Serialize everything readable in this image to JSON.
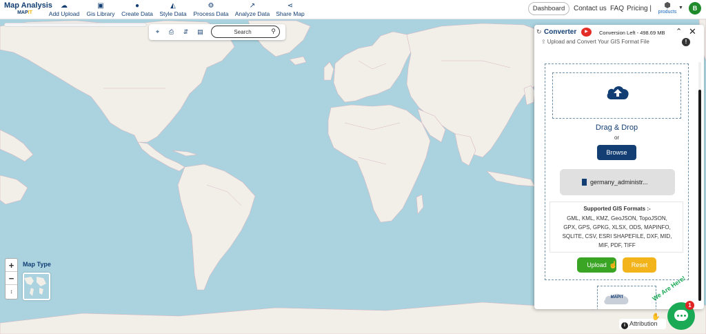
{
  "brand": {
    "title": "Map Analysis",
    "sub_prefix": "MAP",
    "sub_suffix": "IT"
  },
  "nav": [
    {
      "label": "Add Upload",
      "icon": "cloud-upload-icon"
    },
    {
      "label": "Gis Library",
      "icon": "library-icon"
    },
    {
      "label": "Create Data",
      "icon": "location-pin-icon"
    },
    {
      "label": "Style Data",
      "icon": "style-icon"
    },
    {
      "label": "Process Data",
      "icon": "process-icon"
    },
    {
      "label": "Analyze Data",
      "icon": "analyze-icon"
    },
    {
      "label": "Share Map",
      "icon": "share-icon"
    }
  ],
  "header": {
    "dashboard": "Dashboard",
    "contact": "Contact us",
    "faq": "FAQ",
    "pricing": "Pricing |",
    "products": "products",
    "avatar": "B"
  },
  "map_toolbar": {
    "search_placeholder": "Search"
  },
  "map_controls": {
    "zoom_in": "+",
    "zoom_out": "−",
    "reset": "↕",
    "map_type_label": "Map Type"
  },
  "attribution": {
    "label": "Attribution"
  },
  "converter": {
    "title": "Converter",
    "conversion_left": "Conversion Left - 498.69 MB",
    "subtitle": "Upload and Convert Your GIS Format File",
    "drag_drop": "Drag & Drop",
    "or": "or",
    "browse": "Browse",
    "file_name": "germany_administr...",
    "formats_title": "Supported GIS Formats :-",
    "formats_lines": [
      "GML, KML, KMZ, GeoJSON, TopoJSON,",
      "GPX, GPS, GPKG, XLSX, ODS, MAPINFO,",
      "SQLITE, CSV, ESRI SHAPEFILE, DXF, MID,",
      "MIF, PDF, TIFF"
    ],
    "upload": "Upload",
    "reset": "Reset",
    "logo_text": "MAPIT"
  },
  "chat": {
    "badge": "1",
    "tagline": "We Are Here!"
  },
  "colors": {
    "brand_navy": "#123e73",
    "accent_yellow": "#f3b41b",
    "upload_green": "#3aa524",
    "ocean": "#aad3df",
    "land": "#f2efe9"
  }
}
